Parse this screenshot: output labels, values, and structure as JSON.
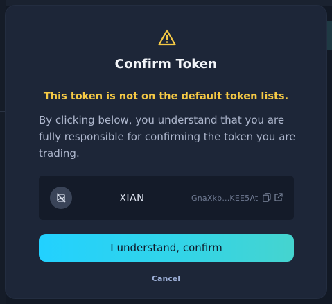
{
  "modal": {
    "title": "Confirm Token",
    "warning": "This token is not on the default token lists.",
    "description": "By clicking below, you understand that you are fully responsible for confirming the token you are trading.",
    "confirm_label": "I understand, confirm",
    "cancel_label": "Cancel"
  },
  "token": {
    "symbol": "XIAN",
    "address_short": "GnaXkb...KEE5At",
    "avatar_icon": "no-image-icon"
  },
  "icons": {
    "warning": "warning-triangle-icon",
    "copy": "copy-icon",
    "external": "external-link-icon"
  },
  "colors": {
    "modal_bg": "#1d2638",
    "warning_text": "#f5c945",
    "button_gradient_start": "#22d1ff",
    "button_gradient_end": "#45d4cf"
  }
}
